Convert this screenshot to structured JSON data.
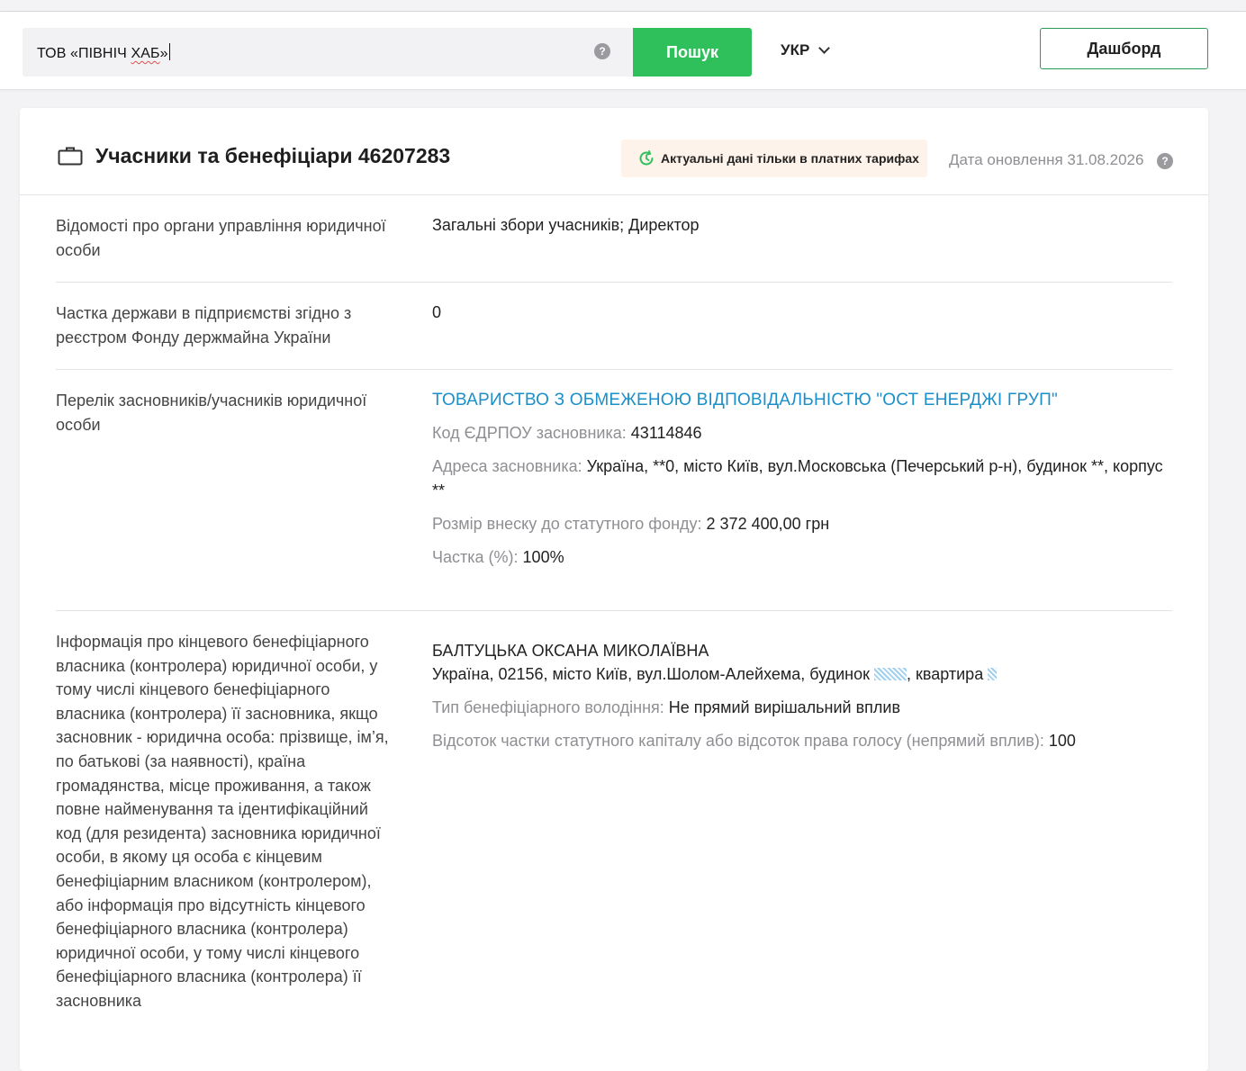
{
  "search": {
    "value_prefix": "ТОВ «ПІВНІЧ ",
    "value_flagged": "ХАБ",
    "value_suffix": "»",
    "help": "?",
    "button_label": "Пошук"
  },
  "lang": {
    "selected": "УКР"
  },
  "dashboard_label": "Дашборд",
  "card": {
    "title": "Учасники та бенефіціари 46207283",
    "notice": "Актуальні дані тільки в платних тарифах",
    "update_date": "Дата оновлення 31.08.2026",
    "help": "?"
  },
  "rows": {
    "governance": {
      "label": "Відомості про органи управління юридичної особи",
      "value": "Загальні збори учасників; Директор"
    },
    "state_share": {
      "label": "Частка держави в підприємстві згідно з реєстром Фонду держмайна України",
      "value": "0"
    },
    "founders": {
      "label": "Перелік засновників/учасників юридичної особи",
      "name": "ТОВАРИСТВО З ОБМЕЖЕНОЮ ВІДПОВІДАЛЬНІСТЮ \"ОСТ ЕНЕРДЖІ ГРУП\"",
      "code_label": "Код ЄДРПОУ засновника:",
      "code_value": "43114846",
      "address_label": "Адреса засновника:",
      "address_value": "Україна, **0, місто Київ, вул.Московська (Печерський р-н), будинок **, корпус **",
      "contribution_label": "Розмір внеску до статутного фонду:",
      "contribution_value": "2 372 400,00 грн",
      "share_label": "Частка (%):",
      "share_value": "100%"
    },
    "beneficiary": {
      "label": "Інформація про кінцевого бенефіціарного власника (контролера) юридичної особи, у тому числі кінцевого бенефіціарного власника (контролера) її засновника, якщо засновник - юридична особа: прізвище, ім’я, по батькові (за наявності), країна громадянства, місце проживання, а також повне найменування та ідентифікаційний код (для резидента) засновника юридичної особи, в якому ця особа є кінцевим бенефіціарним власником (контролером), або інформація про відсутність кінцевого бенефіціарного власника (контролера) юридичної особи, у тому числі кінцевого бенефіціарного власника (контролера) її засновника",
      "name": "БАЛТУЦЬКА ОКСАНА МИКОЛАЇВНА",
      "address_prefix": "Україна, 02156, місто Київ, вул.Шолом-Алейхема, будинок ",
      "address_middle": ", квартира ",
      "ownership_label": "Тип бенефіціарного володіння:",
      "ownership_value": "Не прямий вирішальний вплив",
      "percent_label": "Відсоток частки статутного капіталу або відсоток права голосу (непрямий вплив):",
      "percent_value": "100"
    }
  },
  "colors": {
    "accent_green": "#2fbf5b",
    "link_blue": "#1a8fc9",
    "muted_gray": "#8e8e93",
    "notice_bg": "#fdf3ea"
  }
}
